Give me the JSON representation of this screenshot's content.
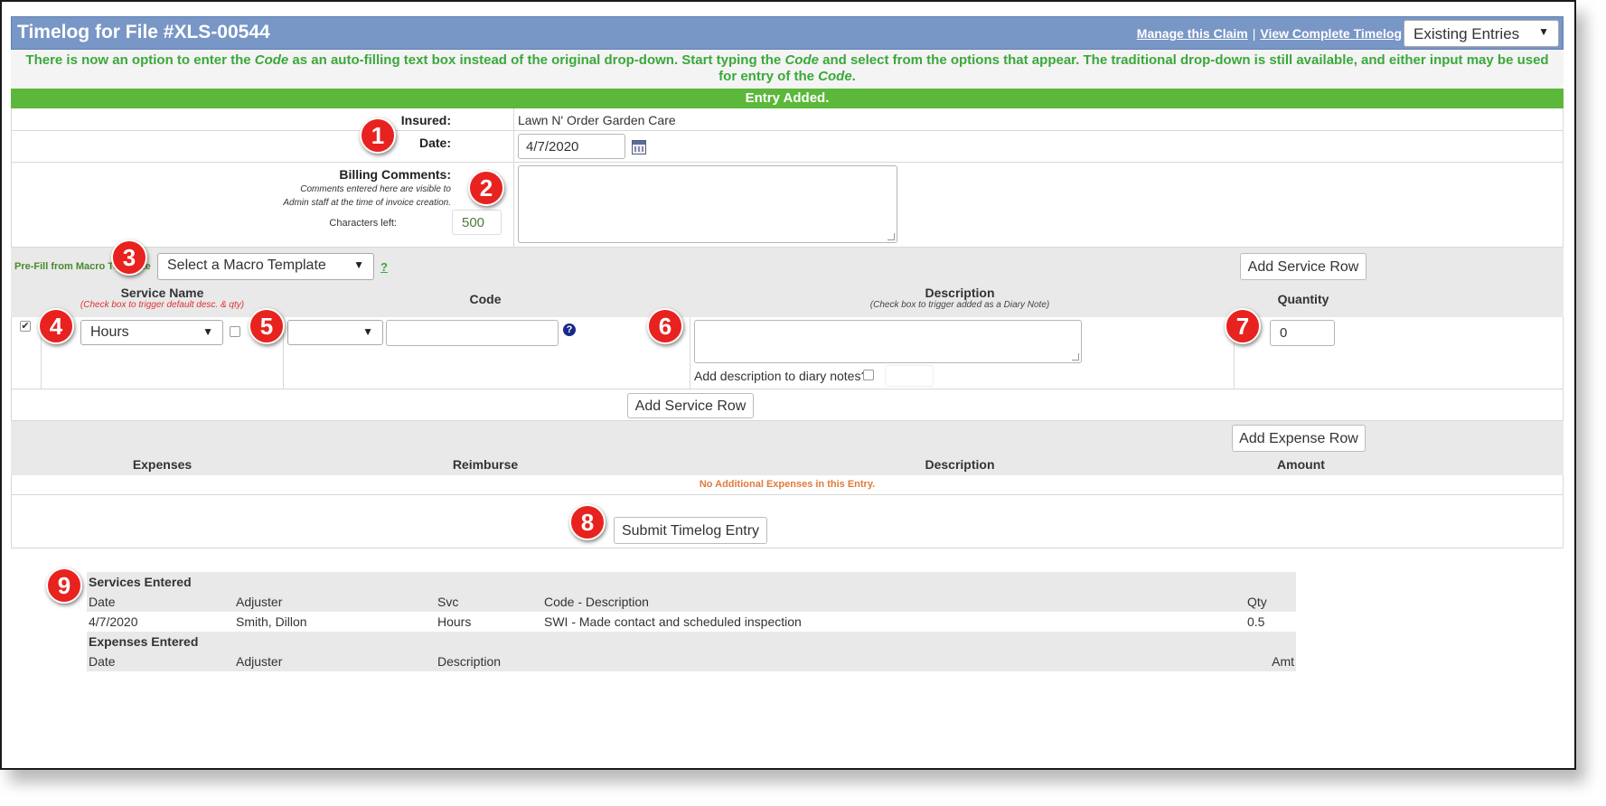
{
  "header": {
    "title": "Timelog for File #XLS-00544",
    "link_manage": "Manage this Claim",
    "separator": "|",
    "link_view": "View Complete Timelog",
    "entries_select": "Existing Entries"
  },
  "notice": {
    "part1": "There is now an option to enter the ",
    "code1": "Code",
    "part2": " as an auto-filling text box instead of the original drop-down. Start typing the ",
    "code2": "Code",
    "part3": " and select from the options that appear. The traditional drop-down is still available, and either input may be used for entry of the ",
    "code3": "Code",
    "part4": "."
  },
  "status": "Entry Added.",
  "form": {
    "insured_label": "Insured:",
    "insured_value": "Lawn N' Order Garden Care",
    "date_label": "Date:",
    "date_value": "4/7/2020",
    "billing_label": "Billing Comments:",
    "billing_note1": "Comments entered here are visible to",
    "billing_note2": "Admin staff at the time of invoice creation.",
    "chars_label": "Characters left:",
    "chars_value": "500",
    "macro_label": "Pre-Fill from Macro Template",
    "macro_select": "Select a Macro Template",
    "macro_help": "?",
    "add_service_row": "Add Service Row"
  },
  "service_table": {
    "col_service": "Service Name",
    "col_service_sub": "(Check box to trigger default desc. & qty)",
    "col_code": "Code",
    "col_desc": "Description",
    "col_desc_sub": "(Check box to trigger added as a Diary Note)",
    "col_qty": "Quantity",
    "service_value": "Hours",
    "code_value": "",
    "diary_label": "Add description to diary notes?",
    "qty_value": "0",
    "row_checked": true
  },
  "expenses": {
    "add_expense_row": "Add Expense Row",
    "col_expenses": "Expenses",
    "col_reimburse": "Reimburse",
    "col_desc": "Description",
    "col_amount": "Amount",
    "empty_msg": "No Additional Expenses in this Entry."
  },
  "submit_label": "Submit Timelog Entry",
  "summary": {
    "services_title": "Services Entered",
    "services_headers": [
      "Date",
      "Adjuster",
      "Svc",
      "Code - Description",
      "Qty"
    ],
    "services_rows": [
      [
        "4/7/2020",
        "Smith, Dillon",
        "Hours",
        "SWI - Made contact and scheduled inspection",
        "0.5"
      ]
    ],
    "expenses_title": "Expenses Entered",
    "expenses_headers": [
      "Date",
      "Adjuster",
      "Description",
      "Amt"
    ]
  },
  "callouts": [
    "1",
    "2",
    "3",
    "4",
    "5",
    "6",
    "7",
    "8",
    "9"
  ],
  "colors": {
    "title_bar": "#7896c6",
    "notice_text": "#3aa83a",
    "status_bar": "#5cb83a",
    "callout": "#e8221e",
    "empty_msg": "#e07a3a"
  }
}
